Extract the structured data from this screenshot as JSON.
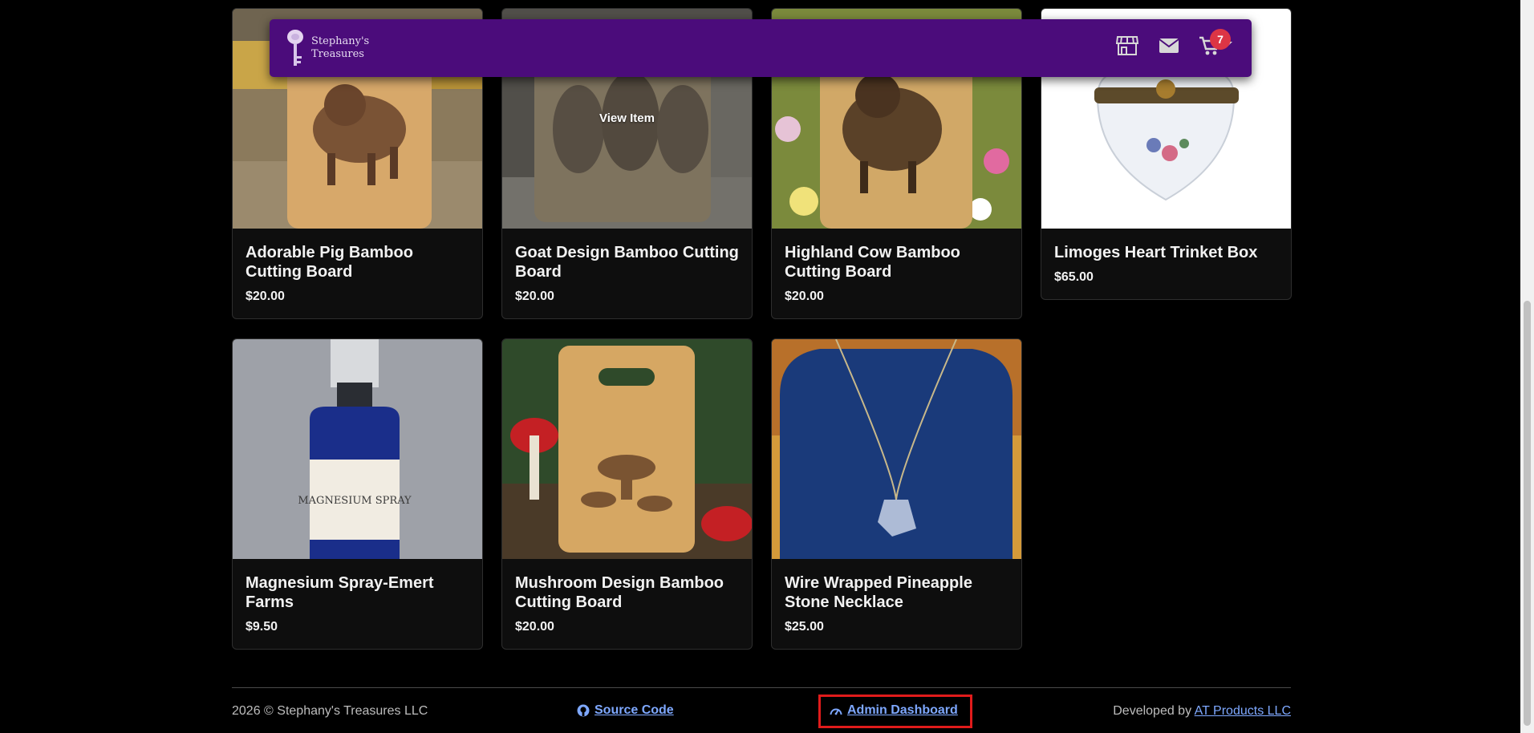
{
  "navbar": {
    "brand_name": "Stephany's Treasures",
    "icons": [
      "key-logo-icon",
      "shop-icon",
      "envelope-icon",
      "cart-icon",
      "caret-down-icon"
    ],
    "cart_count": "7",
    "color": "#4b0c7b"
  },
  "products": [
    {
      "title": "Adorable Pig Bamboo Cutting Board",
      "price": "$20.00"
    },
    {
      "title": "Goat Design Bamboo Cutting Board",
      "price": "$20.00",
      "hover_label": "View Item"
    },
    {
      "title": "Highland Cow Bamboo Cutting Board",
      "price": "$20.00"
    },
    {
      "title": "Limoges Heart Trinket Box",
      "price": "$65.00"
    },
    {
      "title": "Magnesium Spray-Emert Farms",
      "price": "$9.50",
      "label_text": "MAGNESIUM SPRAY"
    },
    {
      "title": "Mushroom Design Bamboo Cutting Board",
      "price": "$20.00"
    },
    {
      "title": "Wire Wrapped Pineapple Stone Necklace",
      "price": "$25.00"
    }
  ],
  "footer": {
    "copyright": "2026 © Stephany's Treasures LLC",
    "source_code": "Source Code",
    "admin_dashboard": "Admin Dashboard",
    "developed_by": "Developed by",
    "developer": "AT Products LLC",
    "highlight_color": "#e01b1b"
  }
}
